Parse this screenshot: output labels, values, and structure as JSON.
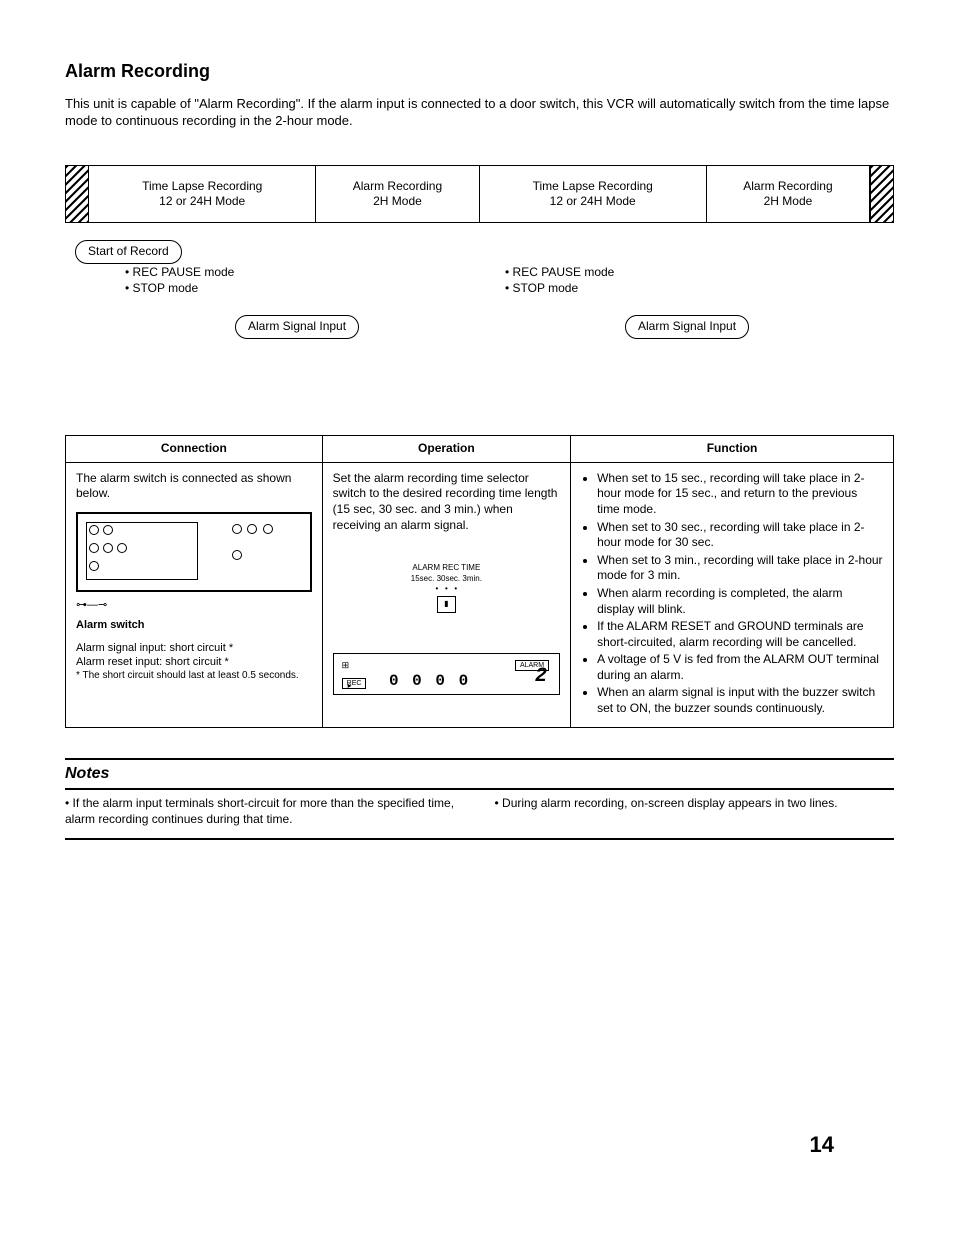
{
  "title": "Alarm Recording",
  "intro": "This unit is capable of \"Alarm Recording\". If the alarm input is connected to a door switch, this VCR will automatically switch from the time lapse mode to continuous recording in the 2-hour mode.",
  "timeline": {
    "cells": [
      {
        "l1": "Time Lapse Recording",
        "l2": "12 or 24H Mode"
      },
      {
        "l1": "Alarm Recording",
        "l2": "2H Mode"
      },
      {
        "l1": "Time Lapse Recording",
        "l2": "12 or 24H Mode"
      },
      {
        "l1": "Alarm Recording",
        "l2": "2H Mode"
      }
    ],
    "start_label": "Start of Record",
    "mode_a": "REC PAUSE mode",
    "mode_b": "STOP mode",
    "signal_label": "Alarm Signal Input"
  },
  "table": {
    "headers": {
      "conn": "Connection",
      "op": "Operation",
      "func": "Function"
    },
    "conn": {
      "lead": "The alarm switch is connected as shown below.",
      "switch_label": "Alarm switch",
      "note1": "Alarm signal input:  short circuit *",
      "note2": "Alarm reset input:   short circuit *",
      "foot": "*   The short circuit should last at least 0.5 seconds."
    },
    "op": {
      "lead": "Set the alarm recording time selector switch to the desired recording time length (15 sec, 30 sec. and 3 min.) when receiving an alarm signal.",
      "diag_title": "ALARM REC TIME",
      "diag_sub": "15sec. 30sec. 3min.",
      "rec_label": "REC",
      "alarm_label": "ALARM",
      "counter": "0 0 0 0",
      "big": "2"
    },
    "func": [
      "When set to 15 sec., recording will take place in 2-hour mode for 15 sec., and return to the previous time mode.",
      "When set to 30 sec., recording will take place in 2-hour mode for 30 sec.",
      "When set to 3 min., recording will take place in 2-hour mode for 3 min.",
      "When alarm recording is completed, the alarm display will blink.",
      "If the ALARM RESET and GROUND terminals are short-circuited, alarm recording will be cancelled.",
      "A voltage of 5 V is fed from the ALARM OUT terminal during an alarm.",
      "When an alarm signal is input with the buzzer switch set to ON, the buzzer sounds continuously."
    ]
  },
  "notes": {
    "heading": "Notes",
    "left": "If the alarm input terminals short-circuit for more than the specified time, alarm recording continues during that time.",
    "right": "During alarm recording, on-screen display appears in two lines."
  },
  "page_number": "14"
}
